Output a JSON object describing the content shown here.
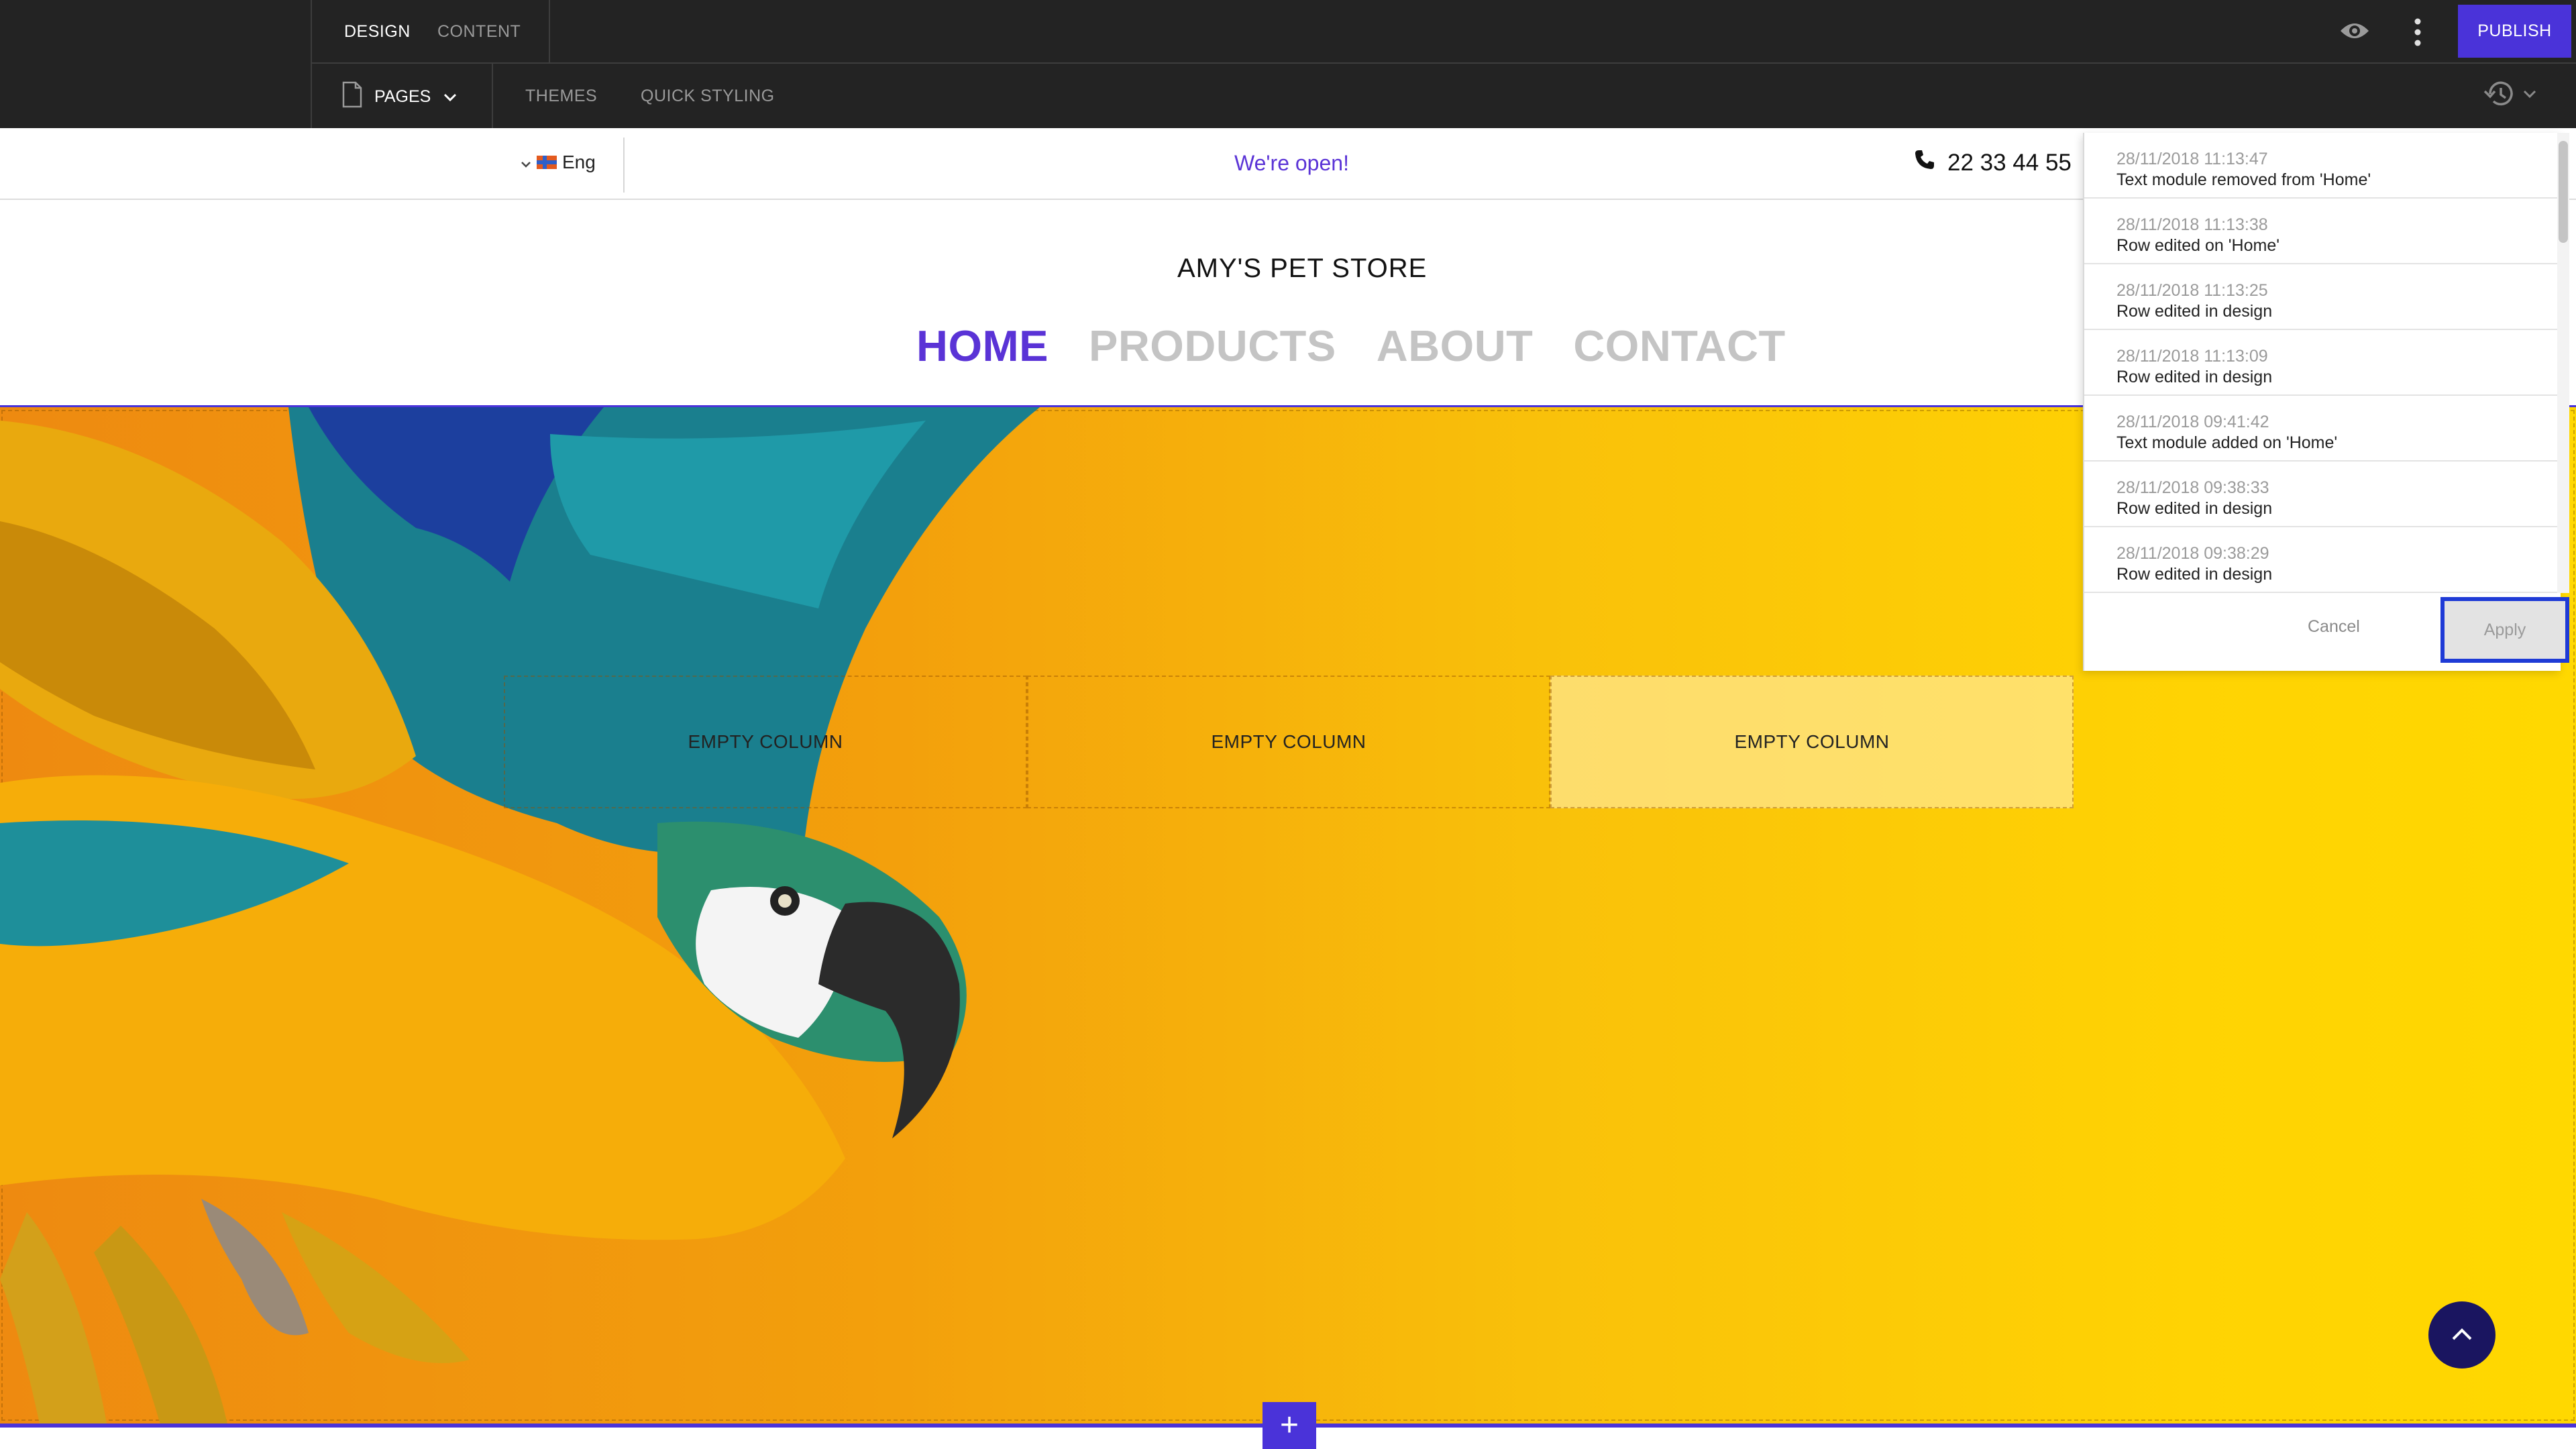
{
  "editor": {
    "tabs": [
      {
        "label": "DESIGN",
        "active": true
      },
      {
        "label": "CONTENT",
        "active": false
      }
    ],
    "subnav": {
      "pages_label": "PAGES",
      "themes_label": "THEMES",
      "quick_styling_label": "QUICK STYLING"
    },
    "publish_label": "PUBLISH",
    "icons": {
      "preview": "eye-icon",
      "more": "kebab-menu-icon",
      "history": "history-icon",
      "pages": "document-icon"
    },
    "colors": {
      "bar_bg": "#232323",
      "accent": "#4a33d9"
    }
  },
  "site": {
    "language": "Eng",
    "announcement": "We're open!",
    "phone": "22 33 44 55",
    "store_name": "AMY'S PET STORE",
    "nav": [
      {
        "label": "HOME",
        "active": true
      },
      {
        "label": "PRODUCTS",
        "active": false
      },
      {
        "label": "ABOUT",
        "active": false
      },
      {
        "label": "CONTACT",
        "active": false
      }
    ],
    "columns": [
      {
        "label": "EMPTY COLUMN"
      },
      {
        "label": "EMPTY COLUMN"
      },
      {
        "label": "EMPTY COLUMN"
      }
    ],
    "add_row_label": "+",
    "colors": {
      "accent": "#5a33d6",
      "hero_start": "#ee8a10",
      "hero_end": "#ffd800"
    }
  },
  "history": {
    "items": [
      {
        "time": "28/11/2018 11:13:47",
        "text": "Text module removed from 'Home'"
      },
      {
        "time": "28/11/2018 11:13:38",
        "text": "Row edited on 'Home'"
      },
      {
        "time": "28/11/2018 11:13:25",
        "text": "Row edited in design"
      },
      {
        "time": "28/11/2018 11:13:09",
        "text": "Row edited in design"
      },
      {
        "time": "28/11/2018 09:41:42",
        "text": "Text module added on 'Home'"
      },
      {
        "time": "28/11/2018 09:38:33",
        "text": "Row edited in design"
      },
      {
        "time": "28/11/2018 09:38:29",
        "text": "Row edited in design"
      }
    ],
    "cancel_label": "Cancel",
    "apply_label": "Apply"
  }
}
